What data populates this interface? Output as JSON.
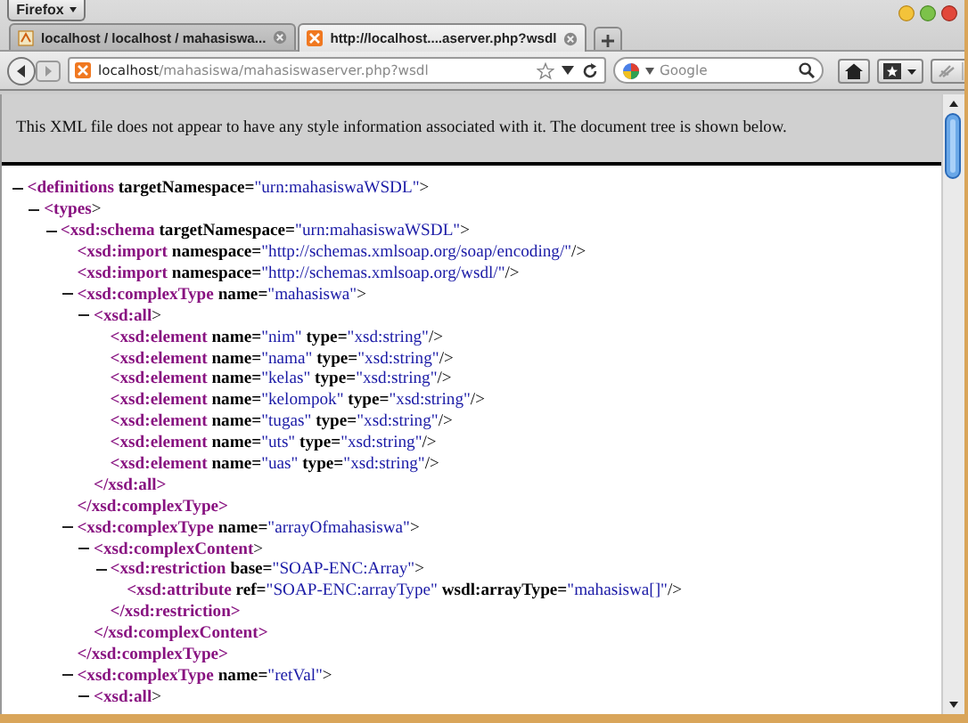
{
  "browser": {
    "menu_button": "Firefox",
    "tabs": [
      {
        "title": "localhost / localhost / mahasiswa...",
        "selected": false
      },
      {
        "title": "http://localhost....aserver.php?wsdl",
        "selected": true
      }
    ],
    "address": {
      "host": "localhost",
      "path": "/mahasiswa/mahasiswaserver.php?wsdl"
    },
    "search": {
      "placeholder": "Google"
    }
  },
  "notice": "This XML file does not appear to have any style information associated with it. The document tree is shown below.",
  "xml_tree": [
    {
      "kind": "open",
      "tag": "<definitions",
      "attributes": [
        {
          "name": "targetNamespace=",
          "value": "\"urn:mahasiswaWSDL\""
        }
      ],
      "end": ">",
      "expanded": true,
      "children": [
        {
          "kind": "open",
          "tag": "<types",
          "end": ">",
          "expanded": true,
          "children": [
            {
              "kind": "open",
              "tag": "<xsd:schema",
              "attributes": [
                {
                  "name": "targetNamespace=",
                  "value": "\"urn:mahasiswaWSDL\""
                }
              ],
              "end": ">",
              "expanded": true,
              "children": [
                {
                  "kind": "leaf",
                  "tag": "<xsd:import",
                  "attributes": [
                    {
                      "name": "namespace=",
                      "value": "\"http://schemas.xmlsoap.org/soap/encoding/\""
                    }
                  ],
                  "end": "/>"
                },
                {
                  "kind": "leaf",
                  "tag": "<xsd:import",
                  "attributes": [
                    {
                      "name": "namespace=",
                      "value": "\"http://schemas.xmlsoap.org/wsdl/\""
                    }
                  ],
                  "end": "/>"
                },
                {
                  "kind": "open",
                  "tag": "<xsd:complexType",
                  "attributes": [
                    {
                      "name": "name=",
                      "value": "\"mahasiswa\""
                    }
                  ],
                  "end": ">",
                  "expanded": true,
                  "close": "</xsd:complexType>",
                  "children": [
                    {
                      "kind": "open",
                      "tag": "<xsd:all",
                      "end": ">",
                      "expanded": true,
                      "close": "</xsd:all>",
                      "children": [
                        {
                          "kind": "leaf",
                          "tag": "<xsd:element",
                          "attributes": [
                            {
                              "name": "name=",
                              "value": "\"nim\""
                            },
                            {
                              "name": "type=",
                              "value": "\"xsd:string\""
                            }
                          ],
                          "end": "/>"
                        },
                        {
                          "kind": "leaf",
                          "tag": "<xsd:element",
                          "attributes": [
                            {
                              "name": "name=",
                              "value": "\"nama\""
                            },
                            {
                              "name": "type=",
                              "value": "\"xsd:string\""
                            }
                          ],
                          "end": "/>"
                        },
                        {
                          "kind": "leaf",
                          "tag": "<xsd:element",
                          "attributes": [
                            {
                              "name": "name=",
                              "value": "\"kelas\""
                            },
                            {
                              "name": "type=",
                              "value": "\"xsd:string\""
                            }
                          ],
                          "end": "/>"
                        },
                        {
                          "kind": "leaf",
                          "tag": "<xsd:element",
                          "attributes": [
                            {
                              "name": "name=",
                              "value": "\"kelompok\""
                            },
                            {
                              "name": "type=",
                              "value": "\"xsd:string\""
                            }
                          ],
                          "end": "/>"
                        },
                        {
                          "kind": "leaf",
                          "tag": "<xsd:element",
                          "attributes": [
                            {
                              "name": "name=",
                              "value": "\"tugas\""
                            },
                            {
                              "name": "type=",
                              "value": "\"xsd:string\""
                            }
                          ],
                          "end": "/>"
                        },
                        {
                          "kind": "leaf",
                          "tag": "<xsd:element",
                          "attributes": [
                            {
                              "name": "name=",
                              "value": "\"uts\""
                            },
                            {
                              "name": "type=",
                              "value": "\"xsd:string\""
                            }
                          ],
                          "end": "/>"
                        },
                        {
                          "kind": "leaf",
                          "tag": "<xsd:element",
                          "attributes": [
                            {
                              "name": "name=",
                              "value": "\"uas\""
                            },
                            {
                              "name": "type=",
                              "value": "\"xsd:string\""
                            }
                          ],
                          "end": "/>"
                        }
                      ]
                    }
                  ]
                },
                {
                  "kind": "open",
                  "tag": "<xsd:complexType",
                  "attributes": [
                    {
                      "name": "name=",
                      "value": "\"arrayOfmahasiswa\""
                    }
                  ],
                  "end": ">",
                  "expanded": true,
                  "close": "</xsd:complexType>",
                  "children": [
                    {
                      "kind": "open",
                      "tag": "<xsd:complexContent",
                      "end": ">",
                      "expanded": true,
                      "close": "</xsd:complexContent>",
                      "children": [
                        {
                          "kind": "open",
                          "tag": "<xsd:restriction",
                          "attributes": [
                            {
                              "name": "base=",
                              "value": "\"SOAP-ENC:Array\""
                            }
                          ],
                          "end": ">",
                          "expanded": true,
                          "close": "</xsd:restriction>",
                          "children": [
                            {
                              "kind": "leaf",
                              "tag": "<xsd:attribute",
                              "attributes": [
                                {
                                  "name": "ref=",
                                  "value": "\"SOAP-ENC:arrayType\""
                                },
                                {
                                  "name": "wsdl:arrayType=",
                                  "value": "\"mahasiswa[]\""
                                }
                              ],
                              "end": "/>"
                            }
                          ]
                        }
                      ]
                    }
                  ]
                },
                {
                  "kind": "open",
                  "tag": "<xsd:complexType",
                  "attributes": [
                    {
                      "name": "name=",
                      "value": "\"retVal\""
                    }
                  ],
                  "end": ">",
                  "expanded": true,
                  "children": [
                    {
                      "kind": "open",
                      "tag": "<xsd:all",
                      "end": ">",
                      "expanded": true
                    }
                  ]
                }
              ]
            }
          ]
        }
      ]
    }
  ]
}
